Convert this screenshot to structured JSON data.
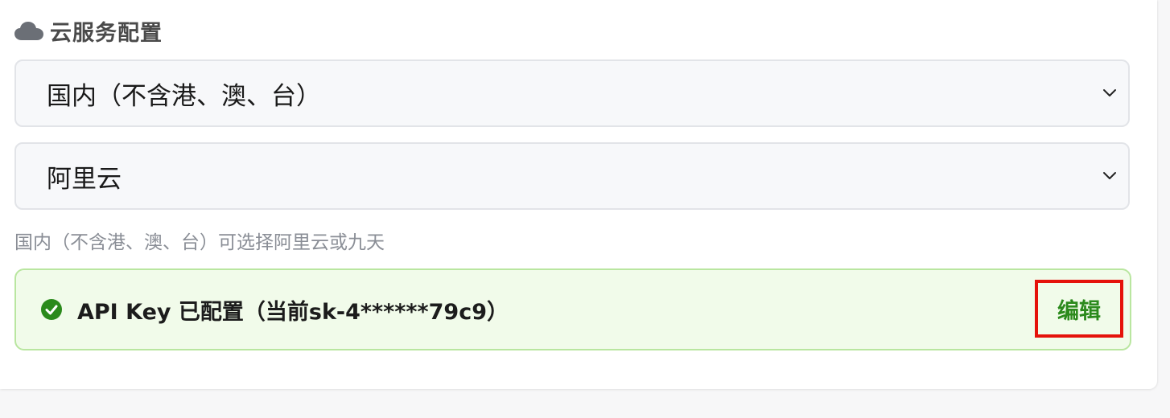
{
  "section": {
    "title": "云服务配置",
    "icon": "cloud-icon"
  },
  "region_select": {
    "value": "国内（不含港、澳、台）"
  },
  "provider_select": {
    "value": "阿里云"
  },
  "hint": "国内（不含港、澳、台）可选择阿里云或九天",
  "api_key_status": {
    "text": "API Key 已配置（当前sk-4******79c9）",
    "icon": "check-circle-icon",
    "edit_label": "编辑"
  },
  "colors": {
    "status_bg": "#f1fbea",
    "status_border": "#b9e6a0",
    "check_green": "#2b8a1c",
    "highlight_red": "#e5120b"
  }
}
